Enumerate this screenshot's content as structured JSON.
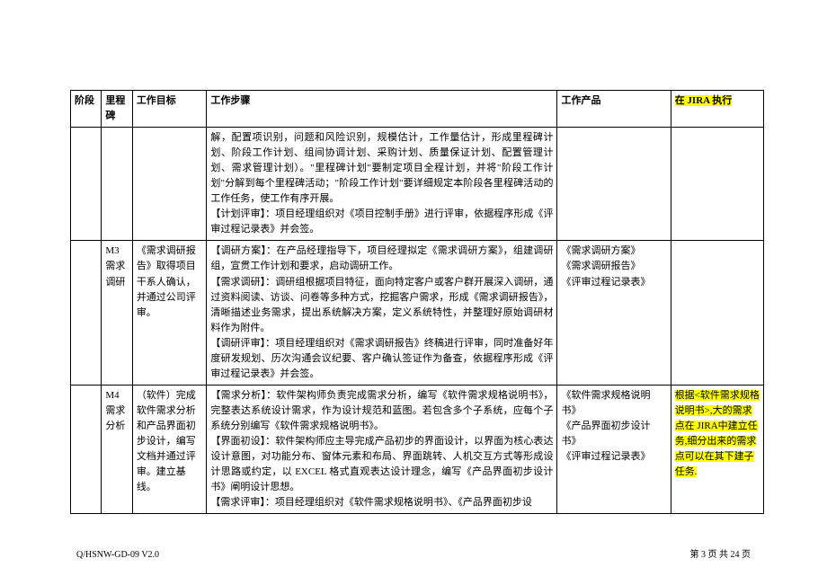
{
  "header": {
    "col_phase": "阶段",
    "col_milestone": "里程碑",
    "col_goal": "工作目标",
    "col_steps": "工作步骤",
    "col_product": "工作产品",
    "col_jira": "在 JIRA 执行"
  },
  "rows": [
    {
      "phase": "",
      "milestone": "",
      "goal": "",
      "steps": "解，配置项识别，问题和风险识别，规模估计，工作量估计，形成里程碑计划、阶段工作计划、组间协调计划、采购计划、质量保证计划、配置管理计划、需求管理计划）。\"里程碑计划\"要制定项目全程计划，并将\"阶段工作计划\"分解到每个里程碑活动；\"阶段工作计划\"要详细规定本阶段各里程碑活动的工作任务，使工作有序开展。\n【计划评审】：项目经理组织对《项目控制手册》进行评审，依据程序形成《评审过程记录表》并会签。",
      "product": "",
      "jira": ""
    },
    {
      "phase": "",
      "milestone": "M3\n需求\n调研",
      "goal": "《需求调研报告》取得项目干系人确认，并通过公司评审。",
      "steps": "【调研方案】：在产品经理指导下，项目经理拟定《需求调研方案》，组建调研组，宣贯工作计划和要求，启动调研工作。\n【需求调研】：调研组根据项目特征，面向特定客户或客户群开展深入调研，通过资料阅读、访谈、问卷等多种方式，挖掘客户需求，形成《需求调研报告》，清晰描述业务需求，提出系统解决方案，定义系统特性，并整理好原始调研材料作为附件。\n【调研评审】：项目经理组织对《需求调研报告》终稿进行评审，同时准备好年度研发规划、历次沟通会议纪要、客户确认签证作为备查，依据程序形成《评审过程记录表》并会签。",
      "product": "《需求调研方案》\n《需求调研报告》\n《评审过程记录表》",
      "jira": ""
    },
    {
      "phase": "",
      "milestone": "M4\n需求\n分析",
      "goal": "（软件）完成软件需求分析和产品界面初步设计，编写文档并通过评审。建立基线。",
      "steps": "【需求分析】：软件架构师负责完成需求分析，编写《软件需求规格说明书》，完整表达系统设计需求，作为设计规范和蓝图。若包含多个子系统，应每个子系统分别编写《软件需求规格说明书》。\n【界面初设】：软件架构师应主导完成产品初步的界面设计，以界面为核心表达设计意图，对功能分布、窗体元素和布局、界面跳转、人机交互方式等形成设计思路或约定，以 EXCEL 格式直观表达设计理念，编写《产品界面初步设计书》阐明设计思想。\n【需求评审】：项目经理组织对《软件需求规格说明书》、《产品界面初步设",
      "product": "《软件需求规格说明书》\n《产品界面初步设计书》\n《评审过程记录表》",
      "jira": "根据<软件需求规格说明书>,大的需求点在 JIRA中建立任务,细分出来的需求点可以在其下建子任务."
    }
  ],
  "footer": {
    "left": "Q/HSNW-GD-09 V2.0",
    "right": "第 3 页 共 24 页"
  }
}
